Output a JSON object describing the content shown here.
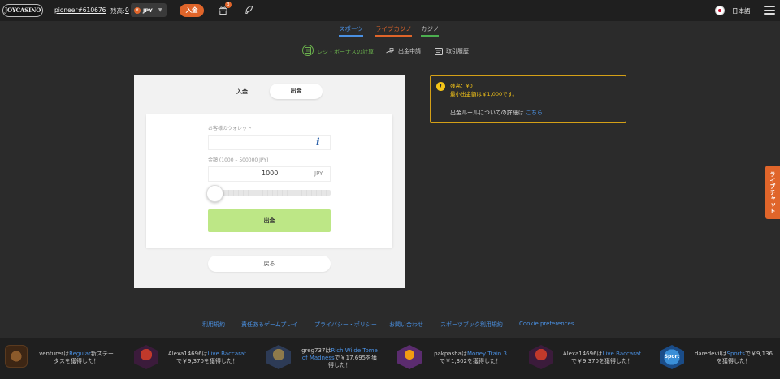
{
  "header": {
    "logo": "JOYCASINO",
    "username": "pioneer#610676",
    "balance_label": "残高:",
    "balance_value": "0",
    "currency": "JPY",
    "currency_icon": "¥",
    "deposit_button": "入金",
    "gift_badge": "3",
    "language": "日本語"
  },
  "nav": {
    "tabs": [
      "スポーツ",
      "ライブカジノ",
      "カジノ"
    ]
  },
  "cashier_tabs": {
    "bonus": "レジ・ボーナスの計算",
    "withdraw_request": "出金申請",
    "history": "取引履歴"
  },
  "form": {
    "toggle_deposit": "入金",
    "toggle_withdraw": "出金",
    "wallet_label": "お客様のウォレット",
    "amount_label": "金額 (1000 – 500000 JPY)",
    "amount_value": "1000",
    "amount_unit": "JPY",
    "slider_fraction": 0,
    "submit": "出金",
    "back": "戻る"
  },
  "notice": {
    "line1": "残高：¥0",
    "line2": "最小出金額は￥1,000です。",
    "rules_text": "出金ルールについての詳細は",
    "rules_link": "こちら"
  },
  "live_chat": "ライブチャット",
  "footer_links": [
    "利用規約",
    "責任あるゲームプレイ",
    "プライバシー・ポリシー",
    "お問い合わせ",
    "スポーツブック利用規約",
    "Cookie preferences"
  ],
  "ticker": [
    {
      "user": "venturer",
      "mid": "は",
      "game": "Regular",
      "rest1": "新ステー",
      "rest2": "タスを獲得した！"
    },
    {
      "user": "Alexa14696",
      "mid": "は",
      "game": "Live Baccarat",
      "rest1": "",
      "rest2": "で￥9,370を獲得した！"
    },
    {
      "user": "greg737",
      "mid": "は",
      "game": "Rich Wilde Tome",
      "rest1": "of Madness",
      "rest2": "で￥17,695を獲",
      "rest3": "得した！"
    },
    {
      "user": "pakpasha",
      "mid": "は",
      "game": "Money Train 3",
      "rest1": "",
      "rest2": "で￥1,302を獲得した！"
    },
    {
      "user": "Alexa14696",
      "mid": "は",
      "game": "Live Baccarat",
      "rest1": "",
      "rest2": "で￥9,370を獲得した！"
    },
    {
      "user": "daredevil",
      "mid": "は",
      "game": "Sports",
      "rest1": "で￥9,136",
      "rest2": "を獲得した！"
    }
  ],
  "sport_tile_label": "Sport"
}
